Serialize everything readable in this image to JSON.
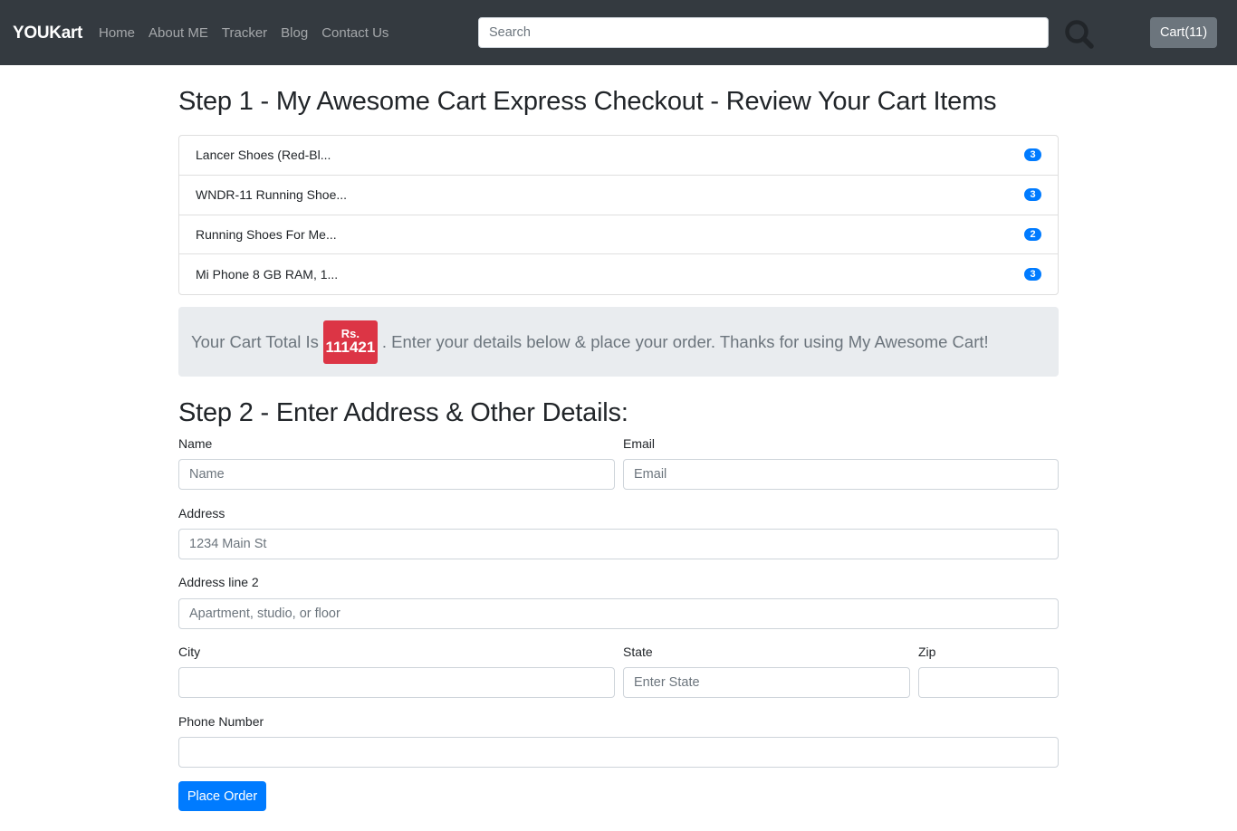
{
  "navbar": {
    "brand": "YOUKart",
    "links": [
      {
        "label": "Home"
      },
      {
        "label": "About ME"
      },
      {
        "label": "Tracker"
      },
      {
        "label": "Blog"
      },
      {
        "label": "Contact Us"
      }
    ],
    "search": {
      "placeholder": "Search",
      "value": ""
    },
    "cart_label": "Cart(11)"
  },
  "step1": {
    "title": "Step 1 - My Awesome Cart Express Checkout - Review Your Cart Items",
    "items": [
      {
        "name": "Lancer Shoes (Red-Bl...",
        "qty": "3"
      },
      {
        "name": "WNDR-11 Running Shoe...",
        "qty": "3"
      },
      {
        "name": "Running Shoes For Me...",
        "qty": "2"
      },
      {
        "name": "Mi Phone 8 GB RAM, 1...",
        "qty": "3"
      }
    ],
    "total": {
      "prefix": "Your Cart Total Is",
      "currency": "Rs.",
      "amount": "111421",
      "suffix": ". Enter your details below & place your order. Thanks for using My Awesome Cart!"
    }
  },
  "step2": {
    "title": "Step 2 - Enter Address & Other Details:",
    "name": {
      "label": "Name",
      "placeholder": "Name",
      "value": ""
    },
    "email": {
      "label": "Email",
      "placeholder": "Email",
      "value": ""
    },
    "address": {
      "label": "Address",
      "placeholder": "1234 Main St",
      "value": ""
    },
    "address2": {
      "label": "Address line 2",
      "placeholder": "Apartment, studio, or floor",
      "value": ""
    },
    "city": {
      "label": "City",
      "placeholder": "",
      "value": ""
    },
    "state": {
      "label": "State",
      "placeholder": "Enter State",
      "value": ""
    },
    "zip": {
      "label": "Zip",
      "placeholder": "",
      "value": ""
    },
    "phone": {
      "label": "Phone Number",
      "placeholder": "",
      "value": ""
    },
    "submit_label": "Place Order"
  },
  "colors": {
    "navbar_bg": "#343a40",
    "primary": "#007bff",
    "danger": "#dc3545",
    "secondary": "#6c757d",
    "jumbotron_bg": "#e9ecef"
  },
  "icons": {
    "search_button": "search-icon"
  }
}
